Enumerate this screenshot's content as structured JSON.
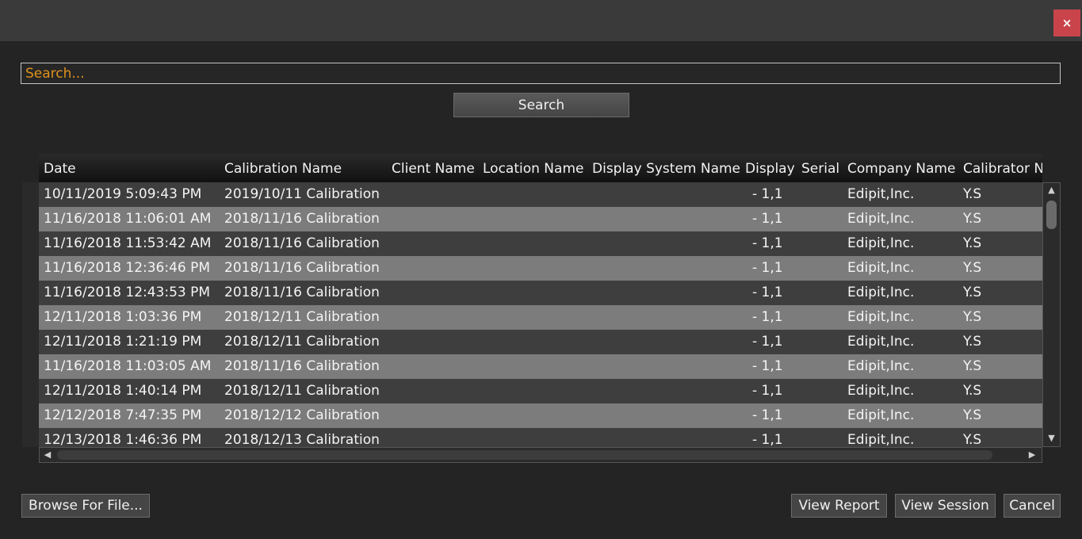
{
  "window": {
    "close_glyph": "×"
  },
  "search": {
    "placeholder": "Search...",
    "button_label": "Search"
  },
  "grid": {
    "columns": [
      "Date",
      "Calibration Name",
      "Client Name",
      "Location Name",
      "Display System Name",
      "Display",
      "Serial",
      "Company Name",
      "Calibrator N"
    ],
    "rows": [
      {
        "date": "10/11/2019 5:09:43 PM",
        "calibration_name": "2019/10/11 Calibration",
        "display": "- 1,1",
        "company": "Edipit,Inc.",
        "calibrator": "Y.S"
      },
      {
        "date": "11/16/2018 11:06:01 AM",
        "calibration_name": "2018/11/16 Calibration",
        "display": "- 1,1",
        "company": "Edipit,Inc.",
        "calibrator": "Y.S"
      },
      {
        "date": "11/16/2018 11:53:42 AM",
        "calibration_name": "2018/11/16 Calibration",
        "display": "- 1,1",
        "company": "Edipit,Inc.",
        "calibrator": "Y.S"
      },
      {
        "date": "11/16/2018 12:36:46 PM",
        "calibration_name": "2018/11/16 Calibration",
        "display": "- 1,1",
        "company": "Edipit,Inc.",
        "calibrator": "Y.S"
      },
      {
        "date": "11/16/2018 12:43:53 PM",
        "calibration_name": "2018/11/16 Calibration",
        "display": "- 1,1",
        "company": "Edipit,Inc.",
        "calibrator": "Y.S"
      },
      {
        "date": "12/11/2018 1:03:36 PM",
        "calibration_name": "2018/12/11 Calibration",
        "display": "- 1,1",
        "company": "Edipit,Inc.",
        "calibrator": "Y.S"
      },
      {
        "date": "12/11/2018 1:21:19 PM",
        "calibration_name": "2018/12/11 Calibration",
        "display": "- 1,1",
        "company": "Edipit,Inc.",
        "calibrator": "Y.S"
      },
      {
        "date": "11/16/2018 11:03:05 AM",
        "calibration_name": "2018/11/16 Calibration",
        "display": "- 1,1",
        "company": "Edipit,Inc.",
        "calibrator": "Y.S"
      },
      {
        "date": "12/11/2018 1:40:14 PM",
        "calibration_name": "2018/12/11 Calibration",
        "display": "- 1,1",
        "company": "Edipit,Inc.",
        "calibrator": "Y.S"
      },
      {
        "date": "12/12/2018 7:47:35 PM",
        "calibration_name": "2018/12/12 Calibration",
        "display": "- 1,1",
        "company": "Edipit,Inc.",
        "calibrator": "Y.S"
      },
      {
        "date": "12/13/2018 1:46:36 PM",
        "calibration_name": "2018/12/13 Calibration",
        "display": "- 1,1",
        "company": "Edipit,Inc.",
        "calibrator": "Y.S"
      }
    ]
  },
  "footer": {
    "browse_label": "Browse For File...",
    "view_report_label": "View Report",
    "view_session_label": "View Session",
    "cancel_label": "Cancel"
  },
  "icons": {
    "scroll_up": "scroll-up-arrow-icon",
    "scroll_down": "scroll-down-arrow-icon",
    "scroll_left": "scroll-left-arrow-icon",
    "scroll_right": "scroll-right-arrow-icon"
  },
  "colors": {
    "accent_placeholder": "#e0921c",
    "close_button": "#c9444a",
    "row_dark": "#3e3e3e",
    "row_light": "#7c7c7c"
  }
}
